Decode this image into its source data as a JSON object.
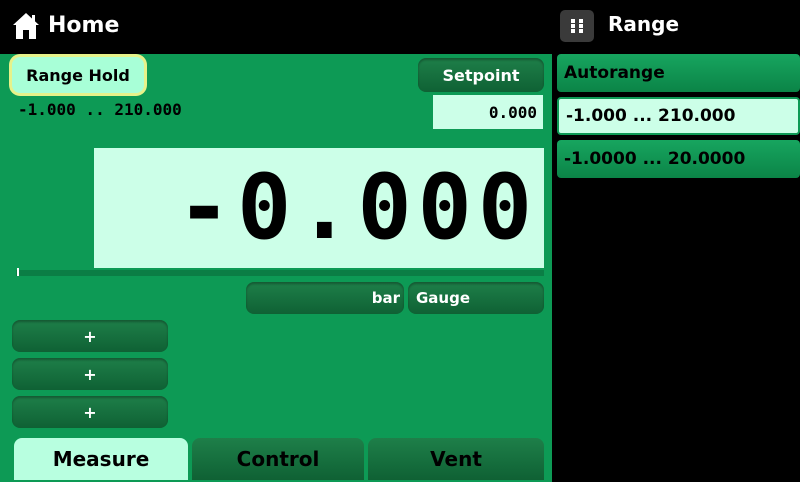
{
  "header": {
    "title": "Home",
    "right_title": "Range"
  },
  "controls": {
    "range_hold_label": "Range Hold",
    "setpoint_label": "Setpoint",
    "range_text": "-1.000 .. 210.000",
    "setpoint_value": "0.000"
  },
  "reading": {
    "value": "-0.000",
    "unit_label": "bar",
    "type_label": "Gauge"
  },
  "plus_buttons": [
    "+",
    "+",
    "+"
  ],
  "tabs": [
    "Measure",
    "Control",
    "Vent"
  ],
  "range_list": [
    "Autorange",
    "-1.000 ... 210.000",
    "-1.0000 ... 20.0000"
  ],
  "colors": {
    "panel_green": "#0d9a55",
    "highlight_mint": "#ccffe8",
    "selected_outline": "#e6f28a"
  },
  "icons": {
    "home": "home-icon",
    "menu": "grid-menu-icon"
  }
}
